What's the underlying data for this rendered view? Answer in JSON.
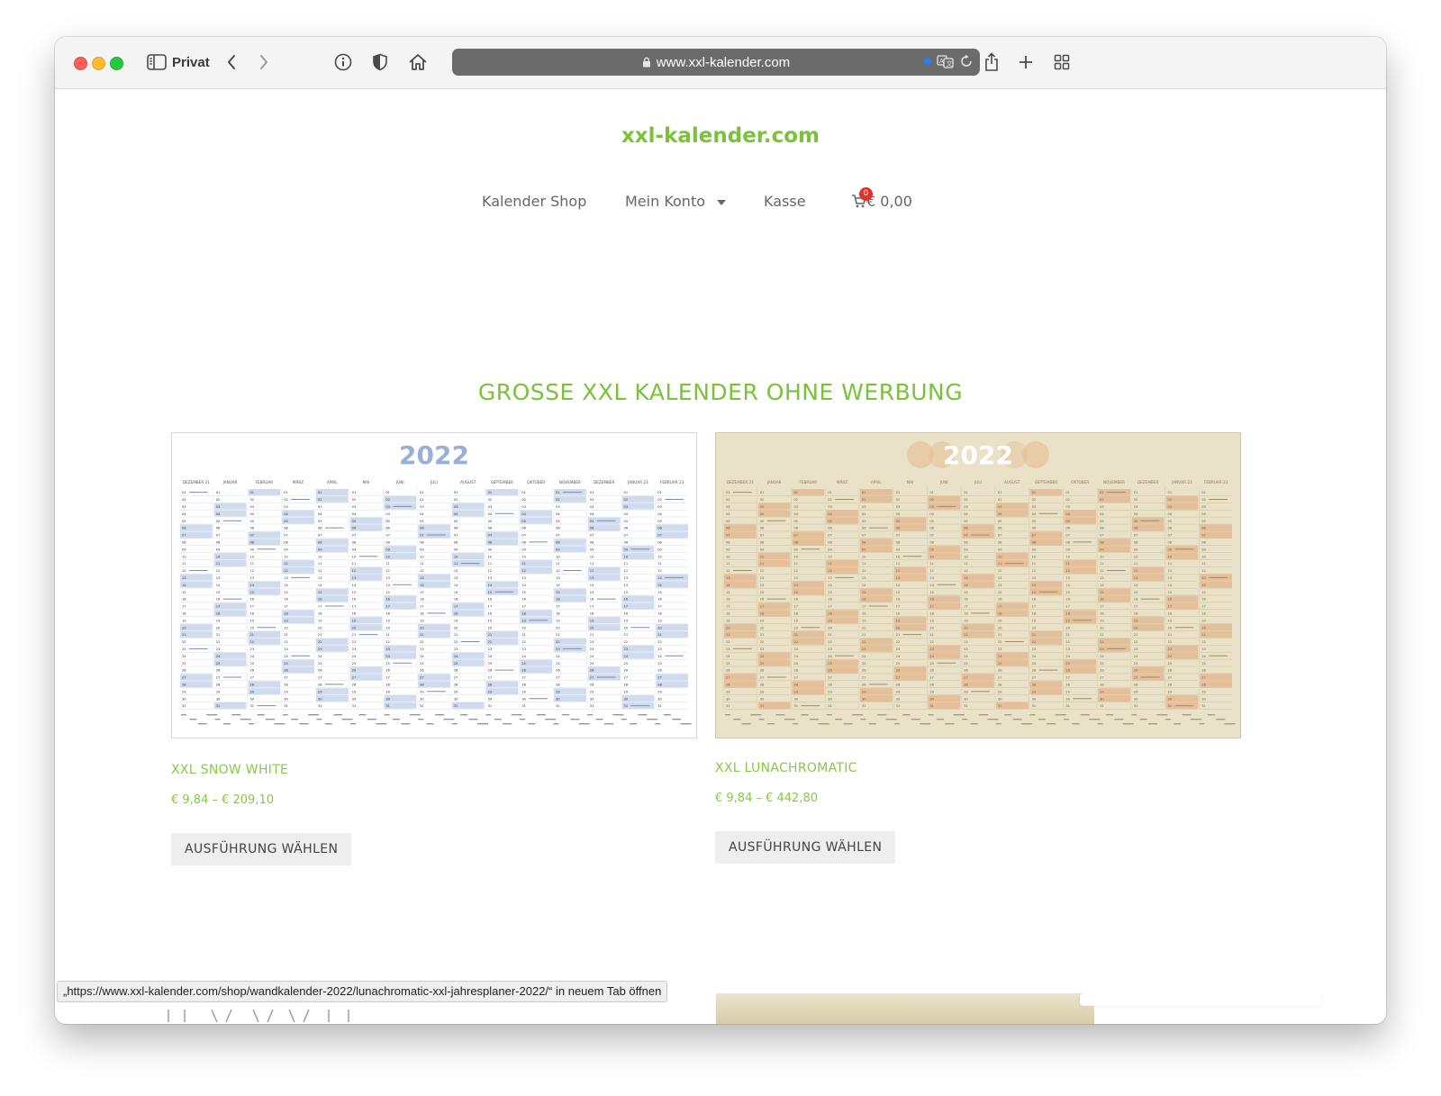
{
  "browser": {
    "private_label": "Privat",
    "url": "www.xxl-kalender.com",
    "status_url": "„https://www.xxl-kalender.com/shop/wandkalender-2022/lunachromatic-xxl-jahresplaner-2022/“ in neuem Tab öffnen"
  },
  "site": {
    "title": "xxl-kalender.com",
    "nav": {
      "shop": "Kalender Shop",
      "account": "Mein Konto",
      "checkout": "Kasse",
      "cart_count": "0",
      "cart_total": "€ 0,00"
    }
  },
  "section": {
    "title": "GROSSE XXL KALENDER OHNE WERBUNG"
  },
  "products": [
    {
      "name": "XXL SNOW WHITE",
      "price": "€ 9,84 – € 209,10",
      "button": "AUSFÜHRUNG WÄHLEN",
      "year": "2022",
      "accent": "#a9bedf",
      "months": [
        "DEZEMBER 21",
        "JANUAR",
        "FEBRUAR",
        "MÄRZ",
        "APRIL",
        "MAI",
        "JUNI",
        "JULI",
        "AUGUST",
        "SEPTEMBER",
        "OKTOBER",
        "NOVEMBER",
        "DEZEMBER",
        "JANUAR 23",
        "FEBRUAR 23"
      ]
    },
    {
      "name": "XXL LUNACHROMATIC",
      "price": "€ 9,84 – € 442,80",
      "button": "AUSFÜHRUNG WÄHLEN",
      "year": "2022",
      "accent": "#e2b78d",
      "months": [
        "DEZEMBER 21",
        "JANUAR",
        "FEBRUAR",
        "MÄRZ",
        "APRIL",
        "MAI",
        "JUNI",
        "JULI",
        "AUGUST",
        "SEPTEMBER",
        "OKTOBER",
        "NOVEMBER",
        "DEZEMBER",
        "JANUAR 23",
        "FEBRUAR 23"
      ]
    }
  ],
  "colors": {
    "brand_green": "#79c23a",
    "price_green": "#88c847",
    "cart_badge": "#e0312a"
  }
}
